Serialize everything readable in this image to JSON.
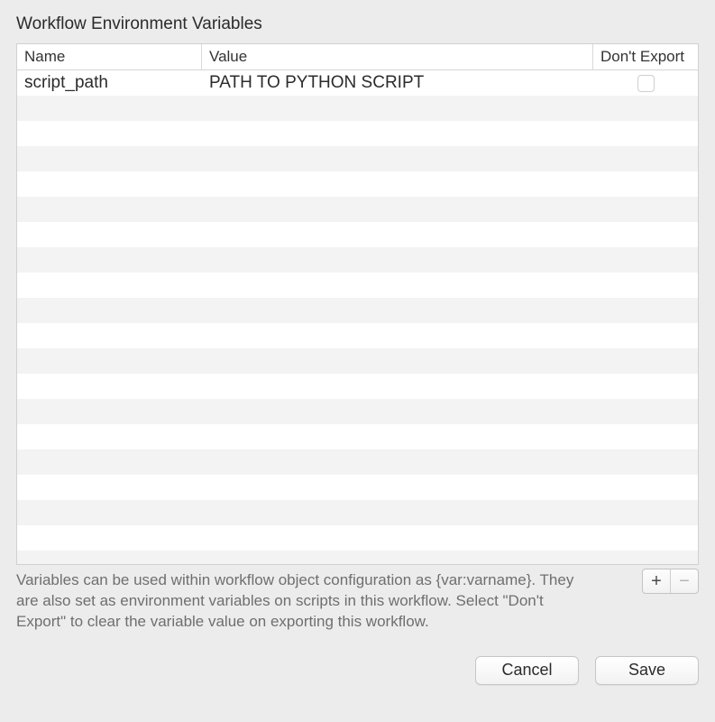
{
  "section_title": "Workflow Environment Variables",
  "columns": {
    "name": "Name",
    "value": "Value",
    "dont_export": "Don't Export"
  },
  "rows": [
    {
      "name": "script_path",
      "value": "PATH TO PYTHON SCRIPT",
      "dont_export": false
    }
  ],
  "blank_row_count": 19,
  "help_text": "Variables can be used within workflow object configuration as {var:varname}. They are also set as environment variables on scripts in this workflow. Select \"Don't Export\" to clear the variable value on exporting this workflow.",
  "buttons": {
    "add": "+",
    "remove": "−",
    "cancel": "Cancel",
    "save": "Save"
  }
}
